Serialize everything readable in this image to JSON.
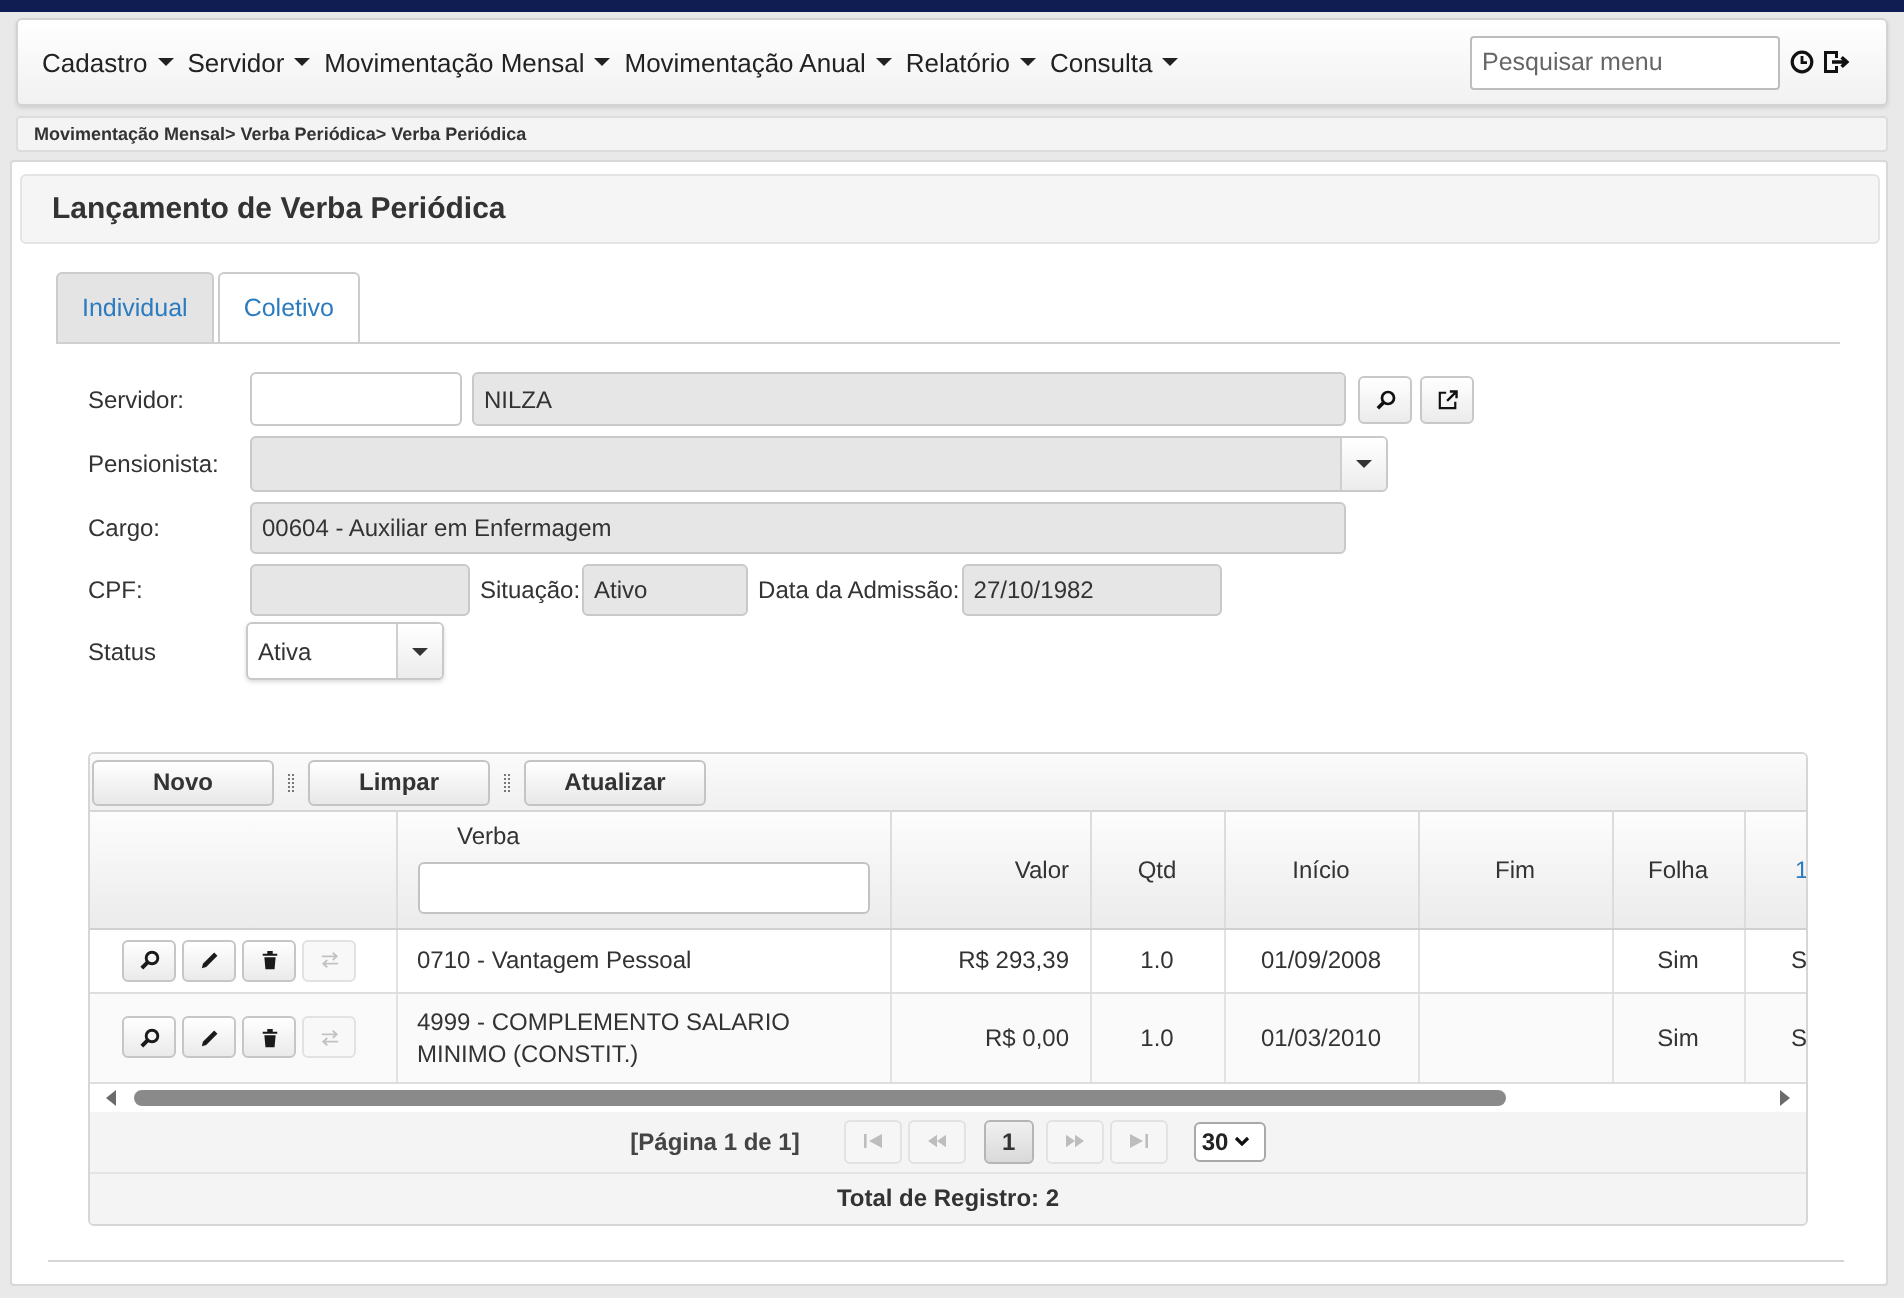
{
  "menu": {
    "items": [
      "Cadastro",
      "Servidor",
      "Movimentação Mensal",
      "Movimentação Anual",
      "Relatório",
      "Consulta"
    ],
    "search": {
      "placeholder": "Pesquisar menu"
    }
  },
  "breadcrumb": "Movimentação Mensal> Verba Periódica> Verba Periódica",
  "page": {
    "title": "Lançamento de Verba Periódica"
  },
  "tabs": [
    {
      "label": "Individual",
      "selected": true
    },
    {
      "label": "Coletivo",
      "selected": false
    }
  ],
  "form": {
    "servidor": {
      "label": "Servidor:",
      "code": {
        "disabled": false
      },
      "name": {
        "value": "NILZA",
        "disabled": true
      }
    },
    "pensionista": {
      "label": "Pensionista:",
      "disabled": true
    },
    "cargo": {
      "label": "Cargo:",
      "value": "00604 - Auxiliar em Enfermagem",
      "disabled": true
    },
    "cpf": {
      "label": "CPF:",
      "disabled": true
    },
    "situacao": {
      "label": "Situação:",
      "value": "Ativo",
      "disabled": true
    },
    "admissao": {
      "label": "Data da Admissão:",
      "value": "27/10/1982",
      "disabled": true
    },
    "status": {
      "label": "Status",
      "value": "Ativa",
      "disabled": false
    }
  },
  "toolbar": {
    "buttons": [
      "Novo",
      "Limpar",
      "Atualizar"
    ]
  },
  "table": {
    "columns": [
      {
        "label": "Verba",
        "kind": "filter"
      },
      {
        "label": "Valor",
        "kind": "plain"
      },
      {
        "label": "Qtd",
        "kind": "plain"
      },
      {
        "label": "Início",
        "kind": "plain"
      },
      {
        "label": "Fim",
        "kind": "plain"
      },
      {
        "label": "Folha",
        "kind": "plain"
      },
      {
        "label": "1",
        "kind": "link"
      }
    ],
    "rows": [
      {
        "actions": [
          {
            "kind": "view",
            "disabled": false
          },
          {
            "kind": "edit",
            "disabled": false
          },
          {
            "kind": "delete",
            "disabled": false
          },
          {
            "kind": "transfer",
            "disabled": true
          }
        ],
        "cells": [
          "0710 - Vantagem Pessoal",
          "R$ 293,39",
          "1.0",
          "01/09/2008",
          null,
          "Sim",
          "S"
        ]
      },
      {
        "actions": [
          {
            "kind": "view",
            "disabled": false
          },
          {
            "kind": "edit",
            "disabled": false
          },
          {
            "kind": "delete",
            "disabled": false
          },
          {
            "kind": "transfer",
            "disabled": true
          }
        ],
        "cells": [
          "4999 - COMPLEMENTO SALARIO MINIMO (CONSTIT.)",
          "R$ 0,00",
          "1.0",
          "01/03/2010",
          null,
          "Sim",
          "S"
        ]
      }
    ]
  },
  "pagination": {
    "summary": "[Página 1 de 1]",
    "nav_before": [
      {
        "kind": "first",
        "disabled": true
      },
      {
        "kind": "prev",
        "disabled": true
      }
    ],
    "pages": [
      {
        "label": "1",
        "selected": true
      }
    ],
    "nav_after": [
      {
        "kind": "next",
        "disabled": true
      },
      {
        "kind": "last",
        "disabled": true
      }
    ],
    "page_size": "30"
  },
  "footer": {
    "total": "Total de Registro: 2"
  }
}
